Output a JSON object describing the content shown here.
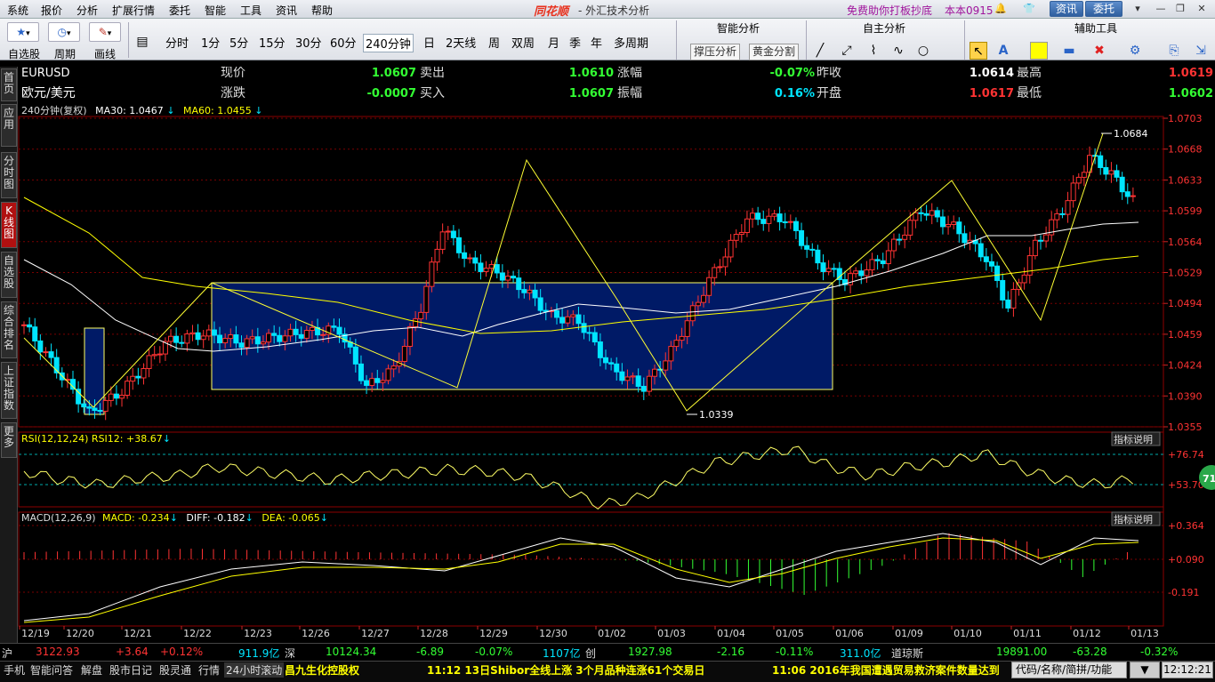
{
  "menu": [
    "系统",
    "报价",
    "分析",
    "扩展行情",
    "委托",
    "智能",
    "工具",
    "资讯",
    "帮助"
  ],
  "app": {
    "logo": "同花顺",
    "title": "- 外汇技术分析",
    "promo": "免费助你打板抄底",
    "version": "本本0915",
    "zixun": "资讯",
    "weituo": "委托"
  },
  "toolbar": {
    "left_labels": [
      "自选股",
      "周期",
      "画线"
    ],
    "periods": [
      "分时",
      "1分",
      "5分",
      "15分",
      "30分",
      "60分",
      "240分钟",
      "日",
      "2天线",
      "周",
      "双周",
      "月",
      "季",
      "年",
      "多周期"
    ],
    "selected_period": "240分钟",
    "sections": {
      "smart": "智能分析",
      "self": "自主分析",
      "aux": "辅助工具"
    },
    "buttons": {
      "support": "撑压分析",
      "golden": "黄金分割"
    }
  },
  "leftnav": [
    "首页",
    "应用",
    "分时图",
    "K线图",
    "自选股",
    "综合排名",
    "上证指数",
    "更多"
  ],
  "quote": {
    "symbol": "EURUSD",
    "name": "欧元/美元",
    "rows": [
      [
        {
          "l": "现价",
          "v": "1.0607"
        },
        {
          "l": "卖出",
          "v": "1.0610"
        },
        {
          "l": "涨幅",
          "v": "-0.07%"
        },
        {
          "l": "昨收",
          "v": "1.0614"
        },
        {
          "l": "最高",
          "v": "1.0619"
        }
      ],
      [
        {
          "l": "涨跌",
          "v": "-0.0007"
        },
        {
          "l": "买入",
          "v": "1.0607"
        },
        {
          "l": "振幅",
          "v": "0.16%"
        },
        {
          "l": "开盘",
          "v": "1.0617"
        },
        {
          "l": "最低",
          "v": "1.0602"
        }
      ]
    ]
  },
  "ma_line": {
    "prefix": "240分钟(复权)",
    "ma30": "MA30: 1.0467",
    "ma60": "MA60: 1.0455"
  },
  "rsi_line": "RSI(12,12,24)  RSI12: +38.67",
  "macd_line": {
    "prefix": "MACD(12,26,9)",
    "macd": "MACD: -0.234",
    "diff": "DIFF: -0.182",
    "dea": "DEA: -0.065"
  },
  "indicator_btn": "指标说明",
  "price_labels": [
    "1.0703",
    "1.0668",
    "1.0633",
    "1.0599",
    "1.0564",
    "1.0529",
    "1.0494",
    "1.0459",
    "1.0424",
    "1.0390",
    "1.0355"
  ],
  "rsi_labels": [
    "+76.74",
    "+53.70"
  ],
  "macd_labels": [
    "+0.364",
    "+0.090",
    "-0.191"
  ],
  "annotations": {
    "high": "1.0684",
    "low": "1.0339"
  },
  "badge": "71",
  "dates": [
    "12/19",
    "12/20",
    "12/21",
    "12/22",
    "12/23",
    "12/26",
    "12/27",
    "12/28",
    "12/29",
    "12/30",
    "01/02",
    "01/03",
    "01/04",
    "01/05",
    "01/06",
    "01/09",
    "01/10",
    "01/11",
    "01/12",
    "01/13"
  ],
  "colors": {
    "up": "#ff3333",
    "down": "#00e5ff",
    "ma": "#ffff00",
    "line": "#ffffff",
    "box": "#001a66"
  },
  "status": [
    {
      "t": "沪",
      "c": "#ddd"
    },
    {
      "t": "3122.93",
      "c": "#ff3333"
    },
    {
      "t": "+3.64",
      "c": "#ff3333"
    },
    {
      "t": "+0.12%",
      "c": "#ff3333"
    },
    {
      "t": "911.9亿",
      "c": "#00e5ff"
    },
    {
      "t": "深",
      "c": "#ddd"
    },
    {
      "t": "10124.34",
      "c": "#33ff33"
    },
    {
      "t": "-6.89",
      "c": "#33ff33"
    },
    {
      "t": "-0.07%",
      "c": "#33ff33"
    },
    {
      "t": "1107亿",
      "c": "#00e5ff"
    },
    {
      "t": "创",
      "c": "#ddd"
    },
    {
      "t": "1927.98",
      "c": "#33ff33"
    },
    {
      "t": "-2.16",
      "c": "#33ff33"
    },
    {
      "t": "-0.11%",
      "c": "#33ff33"
    },
    {
      "t": "311.0亿",
      "c": "#00e5ff"
    },
    {
      "t": "道琼斯",
      "c": "#ddd"
    },
    {
      "t": "19891.00",
      "c": "#33ff33"
    },
    {
      "t": "-63.28",
      "c": "#33ff33"
    },
    {
      "t": "-0.32%",
      "c": "#33ff33"
    }
  ],
  "bottom": {
    "tabs": [
      "手机",
      "智能问答",
      "解盘",
      "股市日记",
      "股灵通",
      "行情",
      "24小时滚动"
    ],
    "stock": "昌九生化控股权",
    "news1": "11:12 13日Shibor全线上涨 3个月品种连涨61个交易日",
    "news2": "11:06 2016年我国遭遇贸易救济案件数量达到",
    "search": "代码/名称/简拼/功能",
    "clock": "12:12:21"
  }
}
